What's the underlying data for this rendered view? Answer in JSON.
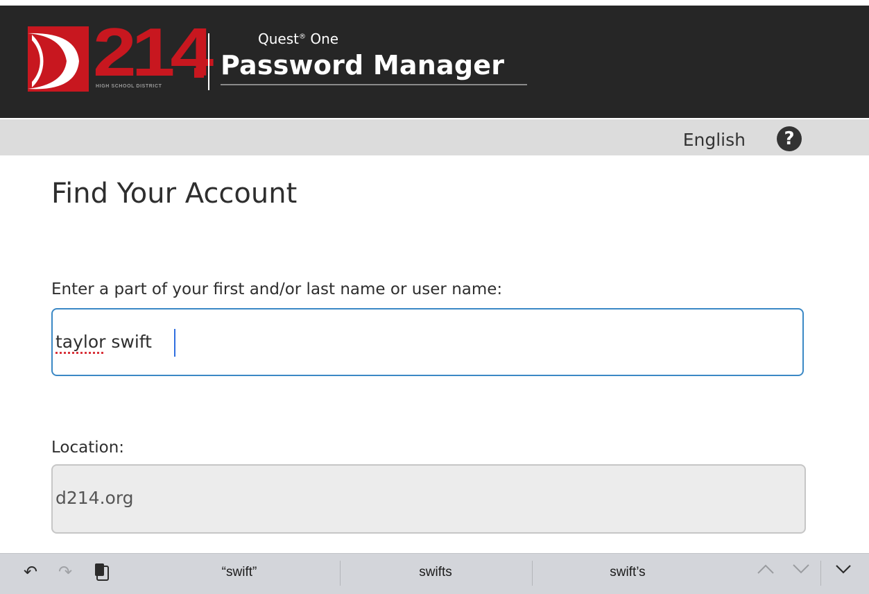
{
  "header": {
    "logo_number": "214",
    "logo_subtitle": "HIGH SCHOOL DISTRICT",
    "product_brand": "Quest",
    "product_brand_mark": "®",
    "product_brand_suffix": "One",
    "product_title": "Password Manager",
    "colors": {
      "background": "#262626",
      "logo_red": "#c8171f"
    }
  },
  "langbar": {
    "language": "English",
    "help_icon": "question-circle-icon"
  },
  "main": {
    "title": "Find Your Account",
    "name_label": "Enter a part of your first and/or last name or user name:",
    "name_value_word1": "taylor",
    "name_value_word2": "swift",
    "location_label": "Location:",
    "location_value": "d214.org"
  },
  "keyboard_bar": {
    "undo_icon": "undo-icon",
    "redo_icon": "redo-icon",
    "paste_icon": "clipboard-icon",
    "suggestions": [
      "“swift”",
      "swifts",
      "swift’s"
    ],
    "prev_icon": "chevron-up-icon",
    "next_icon": "chevron-down-icon",
    "dismiss_icon": "keyboard-dismiss-icon"
  }
}
